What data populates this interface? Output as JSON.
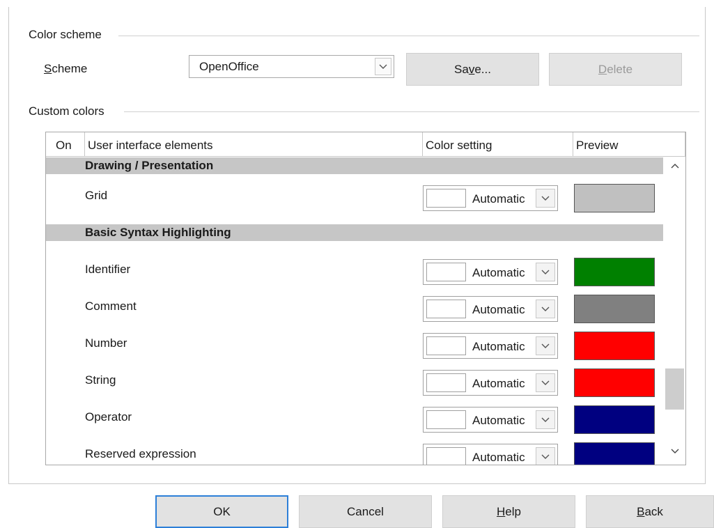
{
  "color_scheme": {
    "section_title": "Color scheme",
    "scheme_label_prefix": "S",
    "scheme_label_rest": "cheme",
    "scheme_value": "OpenOffice",
    "save_pre": "Sa",
    "save_mn": "v",
    "save_post": "e...",
    "delete_mn": "D",
    "delete_post": "elete"
  },
  "custom_colors": {
    "section_title": "Custom colors",
    "columns": {
      "on": "On",
      "elements": "User interface elements",
      "setting": "Color setting",
      "preview": "Preview"
    },
    "groups": {
      "drawing": "Drawing / Presentation",
      "basic": "Basic Syntax Highlighting"
    },
    "rows": [
      {
        "label": "Grid",
        "setting": "Automatic",
        "preview_color": "#c0c0c0"
      },
      {
        "label": "Identifier",
        "setting": "Automatic",
        "preview_color": "#008000"
      },
      {
        "label": "Comment",
        "setting": "Automatic",
        "preview_color": "#808080"
      },
      {
        "label": "Number",
        "setting": "Automatic",
        "preview_color": "#ff0000"
      },
      {
        "label": "String",
        "setting": "Automatic",
        "preview_color": "#ff0000"
      },
      {
        "label": "Operator",
        "setting": "Automatic",
        "preview_color": "#000080"
      },
      {
        "label": "Reserved expression",
        "setting": "Automatic",
        "preview_color": "#000080"
      }
    ]
  },
  "footer": {
    "ok": "OK",
    "cancel": "Cancel",
    "help_mn": "H",
    "help_post": "elp",
    "back_mn": "B",
    "back_post": "ack"
  },
  "icons": {
    "dropdown": "chevron-down-icon",
    "scroll_up": "chevron-up-icon",
    "scroll_down": "chevron-down-icon"
  }
}
